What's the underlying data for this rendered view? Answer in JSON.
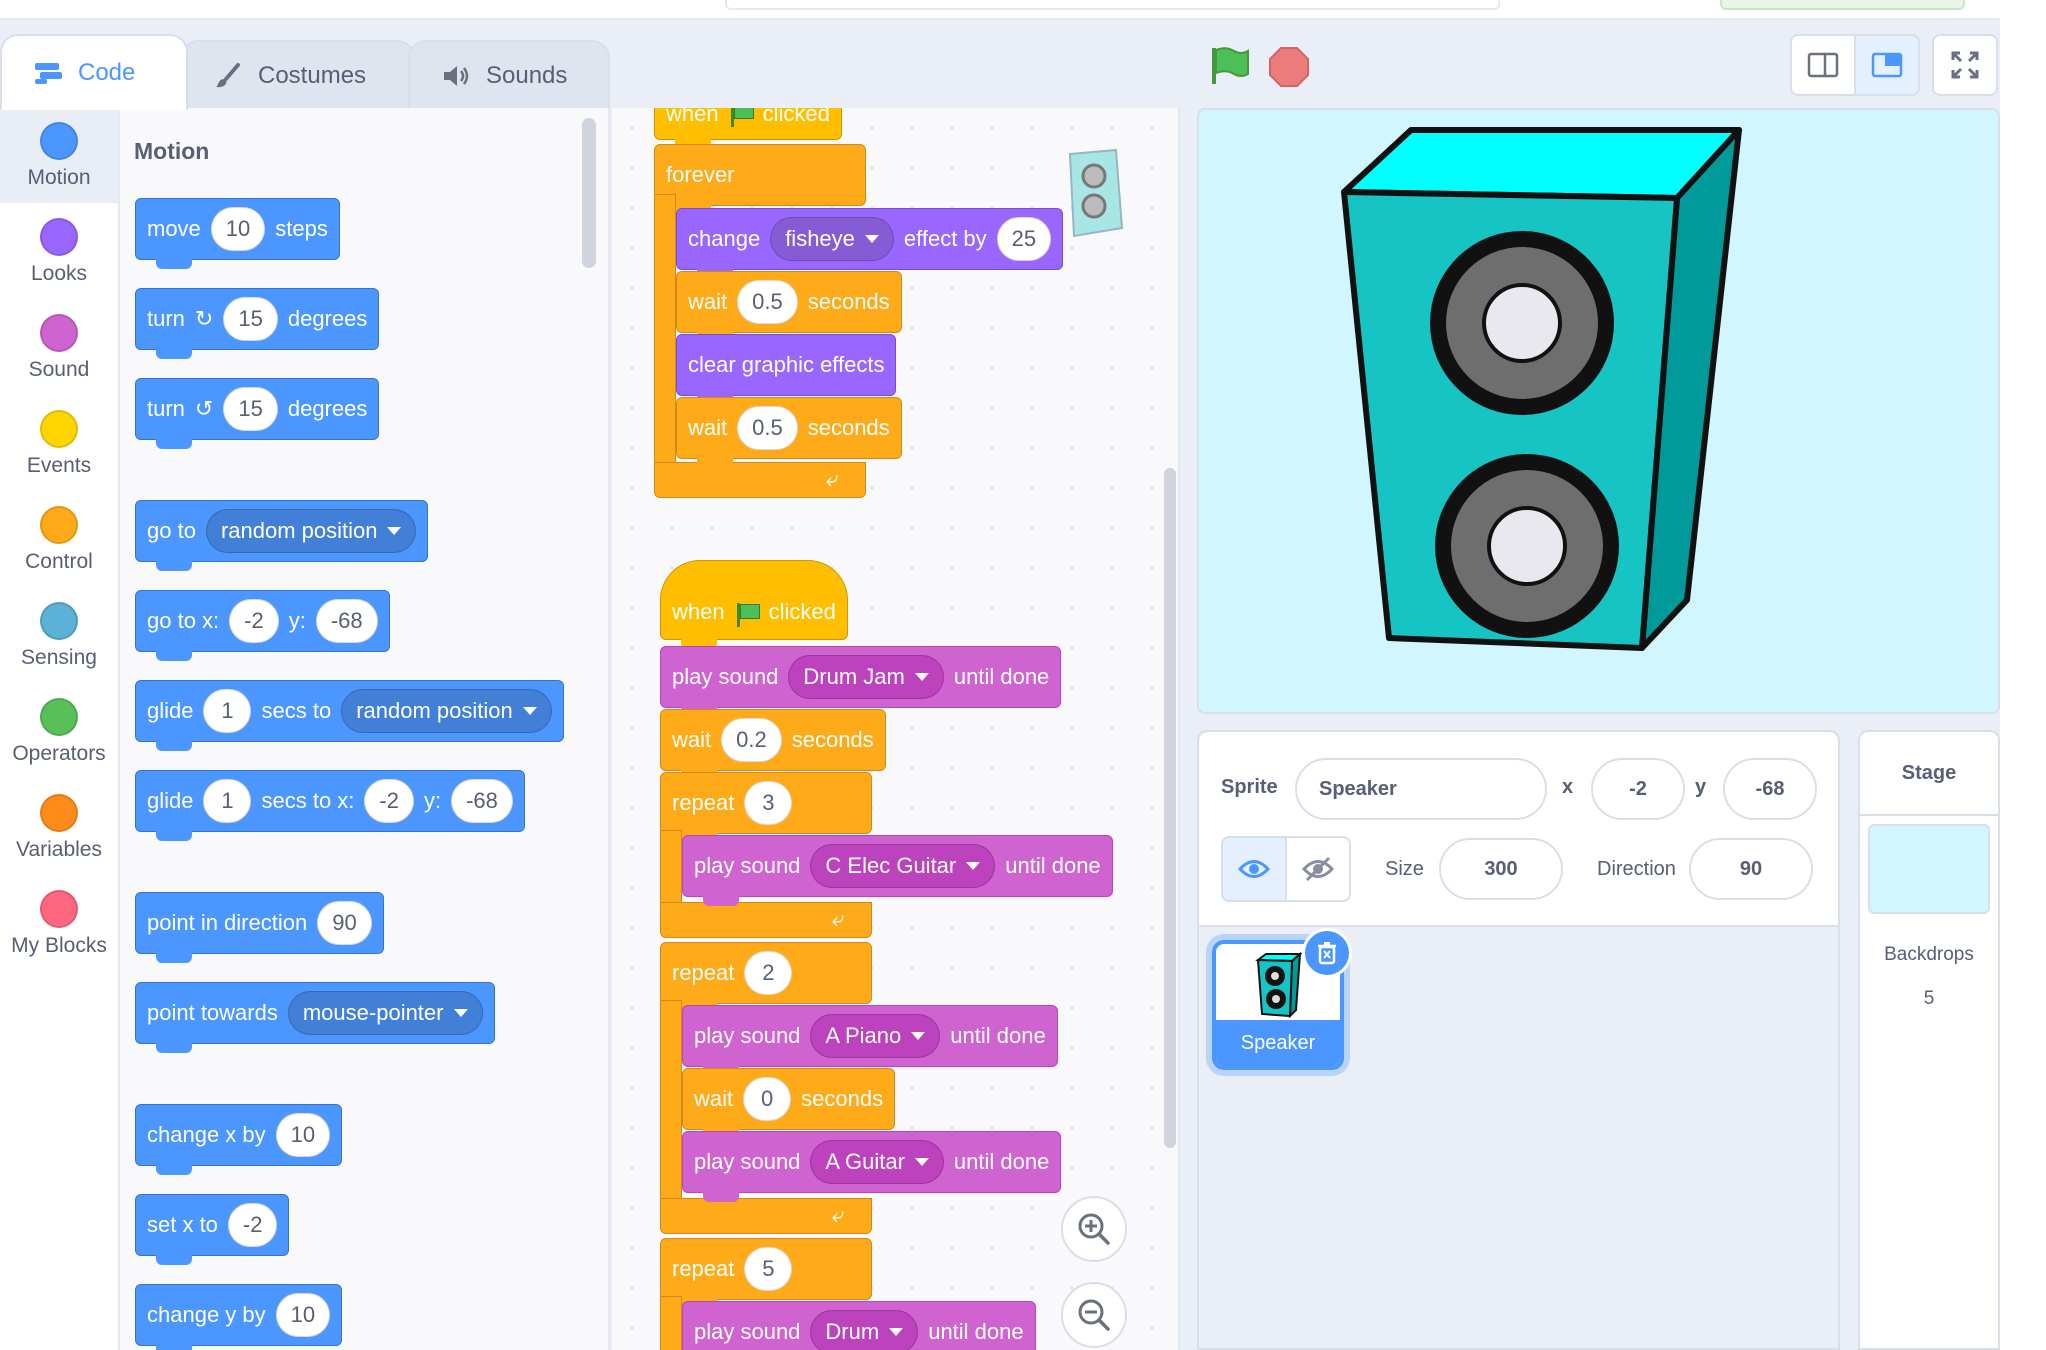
{
  "tabs": [
    {
      "label": "Code",
      "icon": "code-icon"
    },
    {
      "label": "Costumes",
      "icon": "brush-icon"
    },
    {
      "label": "Sounds",
      "icon": "speaker-icon"
    }
  ],
  "categories": [
    {
      "label": "Motion",
      "color": "#4c97ff"
    },
    {
      "label": "Looks",
      "color": "#9966ff"
    },
    {
      "label": "Sound",
      "color": "#cf63cf"
    },
    {
      "label": "Events",
      "color": "#ffd500"
    },
    {
      "label": "Control",
      "color": "#ffab19"
    },
    {
      "label": "Sensing",
      "color": "#5cb1d6"
    },
    {
      "label": "Operators",
      "color": "#59c059"
    },
    {
      "label": "Variables",
      "color": "#ff8c1a"
    },
    {
      "label": "My Blocks",
      "color": "#ff6680"
    }
  ],
  "palette": {
    "title": "Motion",
    "move": {
      "pre": "move",
      "val": "10",
      "post": "steps"
    },
    "turn_right": {
      "pre": "turn",
      "val": "15",
      "post": "degrees"
    },
    "turn_left": {
      "pre": "turn",
      "val": "15",
      "post": "degrees"
    },
    "goto": {
      "pre": "go to",
      "menu": "random position"
    },
    "goto_xy": {
      "pre": "go to x:",
      "x": "-2",
      "mid": "y:",
      "y": "-68"
    },
    "glide_to": {
      "pre": "glide",
      "val": "1",
      "mid": "secs to",
      "menu": "random position"
    },
    "glide_xy": {
      "pre": "glide",
      "val": "1",
      "mid": "secs to x:",
      "x": "-2",
      "mid2": "y:",
      "y": "-68"
    },
    "point_dir": {
      "pre": "point in direction",
      "val": "90"
    },
    "point_towards": {
      "pre": "point towards",
      "menu": "mouse-pointer"
    },
    "change_x": {
      "pre": "change x by",
      "val": "10"
    },
    "set_x": {
      "pre": "set x to",
      "val": "-2"
    },
    "change_y": {
      "pre": "change y by",
      "val": "10"
    }
  },
  "script1": {
    "hat_pre": "when",
    "hat_post": "clicked",
    "forever": "forever",
    "change": {
      "pre": "change",
      "menu": "fisheye",
      "mid": "effect by",
      "val": "25"
    },
    "wait1": {
      "pre": "wait",
      "val": "0.5",
      "post": "seconds"
    },
    "clear": "clear graphic effects",
    "wait2": {
      "pre": "wait",
      "val": "0.5",
      "post": "seconds"
    }
  },
  "script2": {
    "hat_pre": "when",
    "hat_post": "clicked",
    "play1": {
      "pre": "play sound",
      "menu": "Drum Jam",
      "post": "until done"
    },
    "wait1": {
      "pre": "wait",
      "val": "0.2",
      "post": "seconds"
    },
    "repeat1": {
      "pre": "repeat",
      "val": "3"
    },
    "play2": {
      "pre": "play sound",
      "menu": "C Elec Guitar",
      "post": "until done"
    },
    "repeat2": {
      "pre": "repeat",
      "val": "2"
    },
    "play3": {
      "pre": "play sound",
      "menu": "A Piano",
      "post": "until done"
    },
    "wait2": {
      "pre": "wait",
      "val": "0",
      "post": "seconds"
    },
    "play4": {
      "pre": "play sound",
      "menu": "A Guitar",
      "post": "until done"
    },
    "repeat3": {
      "pre": "repeat",
      "val": "5"
    },
    "play5": {
      "pre": "play sound",
      "menu": "Drum",
      "post": "until done"
    }
  },
  "sprite": {
    "label_sprite": "Sprite",
    "name": "Speaker",
    "label_x": "x",
    "x": "-2",
    "label_y": "y",
    "y": "-68",
    "label_size": "Size",
    "size": "300",
    "label_direction": "Direction",
    "direction": "90",
    "thumb_name": "Speaker"
  },
  "stage_pane": {
    "title": "Stage",
    "backdrops_label": "Backdrops",
    "backdrops_count": "5"
  }
}
